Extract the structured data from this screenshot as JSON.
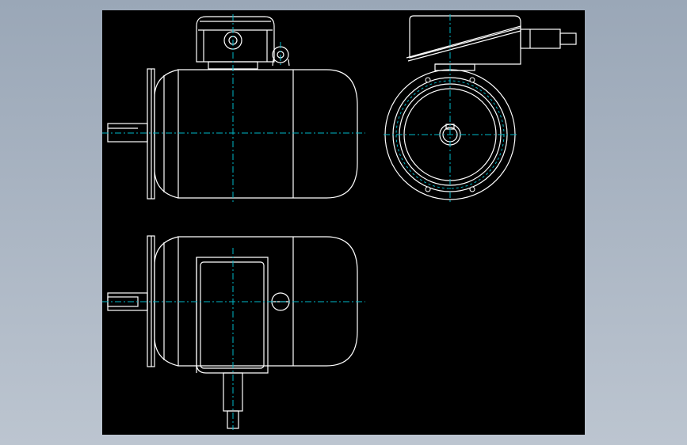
{
  "colors": {
    "background": "#a9b4c2",
    "sheet": "#000000",
    "outline": "#ffffff",
    "centerline": "#00b7c7"
  },
  "views": [
    {
      "name": "side-view-top"
    },
    {
      "name": "front-view"
    },
    {
      "name": "top-view"
    }
  ]
}
